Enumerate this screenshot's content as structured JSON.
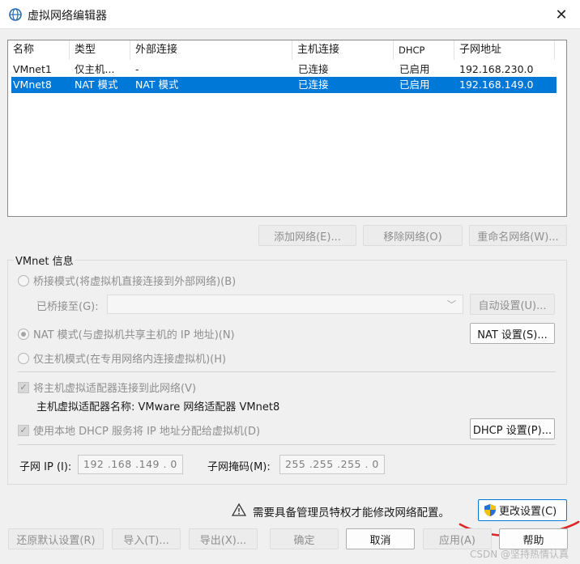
{
  "window": {
    "title": "虚拟网络编辑器",
    "close_glyph": "✕"
  },
  "network_list": {
    "columns": [
      "名称",
      "类型",
      "外部连接",
      "主机连接",
      "DHCP",
      "子网地址"
    ],
    "rows": [
      {
        "name": "VMnet1",
        "type": "仅主机...",
        "external": "-",
        "host": "已连接",
        "dhcp": "已启用",
        "subnet": "192.168.230.0",
        "selected": false
      },
      {
        "name": "VMnet8",
        "type": "NAT 模式",
        "external": "NAT 模式",
        "host": "已连接",
        "dhcp": "已启用",
        "subnet": "192.168.149.0",
        "selected": true
      }
    ]
  },
  "list_buttons": {
    "add": "添加网络(E)...",
    "remove": "移除网络(O)",
    "rename": "重命名网络(W)..."
  },
  "vmnet_info": {
    "label": "VMnet 信息",
    "bridged_radio": "桥接模式(将虚拟机直接连接到外部网络)(B)",
    "bridged_to_label": "已桥接至(G):",
    "bridged_to_value": "",
    "auto_settings": "自动设置(U)...",
    "nat_radio": "NAT 模式(与虚拟机共享主机的 IP 地址)(N)",
    "nat_settings": "NAT 设置(S)...",
    "hostonly_radio": "仅主机模式(在专用网络内连接虚拟机)(H)",
    "connect_adapter_check": "将主机虚拟适配器连接到此网络(V)",
    "adapter_name": "主机虚拟适配器名称: VMware 网络适配器 VMnet8",
    "dhcp_check": "使用本地 DHCP 服务将 IP 地址分配给虚拟机(D)",
    "dhcp_settings": "DHCP 设置(P)...",
    "subnet_ip_label": "子网 IP (I):",
    "subnet_ip_value": "192 .168 .149 .  0",
    "subnet_mask_label": "子网掩码(M):",
    "subnet_mask_value": "255 .255 .255 .  0",
    "selected_mode": "nat"
  },
  "admin_notice": {
    "icon": "warning-icon",
    "text": "需要具备管理员特权才能修改网络配置。",
    "change_settings": "更改设置(C)"
  },
  "footer_buttons": {
    "restore": "还原默认设置(R)",
    "import": "导入(T)...",
    "export": "导出(X)...",
    "ok": "确定",
    "cancel": "取消",
    "apply": "应用(A)",
    "help": "帮助"
  },
  "watermark": "CSDN @坚持热情认真",
  "colors": {
    "selection": "#0078d7",
    "annotation_red": "#e0262b",
    "shield_blue": "#2a6fd6",
    "shield_yellow": "#f4c20d"
  }
}
